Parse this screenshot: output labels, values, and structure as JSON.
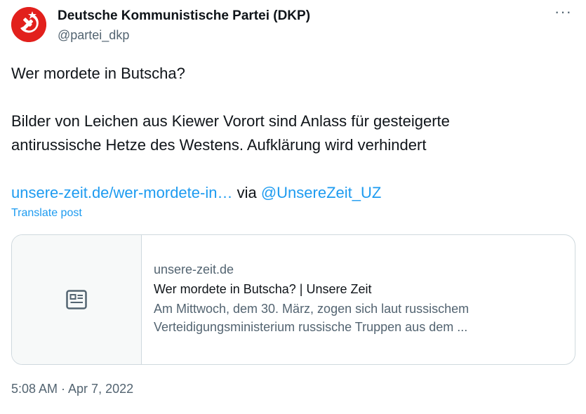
{
  "author": {
    "name": "Deutsche Kommunistische Partei (DKP)",
    "handle": "@partei_dkp",
    "avatar_color": "#e2201c"
  },
  "more_label": "···",
  "post": {
    "line1": "Wer mordete in Butscha?",
    "line2": "Bilder von Leichen aus Kiewer Vorort sind Anlass für gesteigerte",
    "line3": "antirussische Hetze des Westens. Aufklärung wird verhindert",
    "link_text": "unsere-zeit.de/wer-mordete-in…",
    "via_text": " via ",
    "mention": "@UnsereZeit_UZ"
  },
  "translate_label": "Translate post",
  "card": {
    "thumb_icon": "article-icon",
    "domain": "unsere-zeit.de",
    "title": "Wer mordete in Butscha? | Unsere Zeit",
    "desc_line1": "Am Mittwoch, dem 30. März, zogen sich laut russischem",
    "desc_line2": "Verteidigungsministerium russische Truppen aus dem ..."
  },
  "timestamp": "5:08 AM · Apr 7, 2022",
  "colors": {
    "link": "#1d9bf0",
    "secondary_text": "#536471",
    "border": "#cfd9de"
  }
}
